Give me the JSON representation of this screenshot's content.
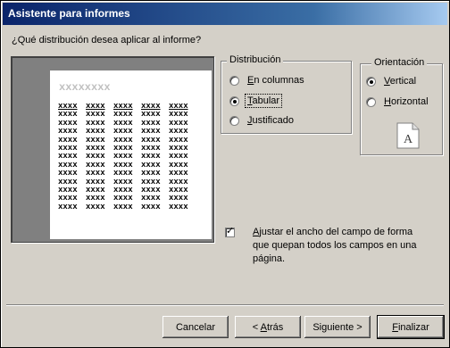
{
  "window": {
    "title": "Asistente para informes"
  },
  "question": "¿Qué distribución desea aplicar al informe?",
  "preview": {
    "title_placeholder": "xxxxxxxx",
    "cell": "xxxx",
    "columns": 5,
    "rows": 13
  },
  "distribution": {
    "label": "Distribución",
    "options": [
      {
        "prefix": "",
        "accel": "E",
        "suffix": "n columnas",
        "selected": false,
        "focused": false
      },
      {
        "prefix": "",
        "accel": "T",
        "suffix": "abular",
        "selected": true,
        "focused": true
      },
      {
        "prefix": "",
        "accel": "J",
        "suffix": "ustificado",
        "selected": false,
        "focused": false
      }
    ]
  },
  "orientation": {
    "label": "Orientación",
    "options": [
      {
        "prefix": "",
        "accel": "V",
        "suffix": "ertical",
        "selected": true
      },
      {
        "prefix": "",
        "accel": "H",
        "suffix": "orizontal",
        "selected": false
      }
    ],
    "icon_letter": "A"
  },
  "fit_checkbox": {
    "checked": true,
    "accel": "A",
    "text": "justar el ancho del campo de forma que quepan todos los campos en una página."
  },
  "buttons": {
    "cancel": {
      "prefix": "Cancelar",
      "accel": "",
      "suffix": ""
    },
    "back": {
      "prefix": "< ",
      "accel": "A",
      "suffix": "trás"
    },
    "next": {
      "prefix": "Si",
      "accel": "g",
      "suffix": "uiente >"
    },
    "finish": {
      "prefix": "",
      "accel": "F",
      "suffix": "inalizar"
    }
  }
}
